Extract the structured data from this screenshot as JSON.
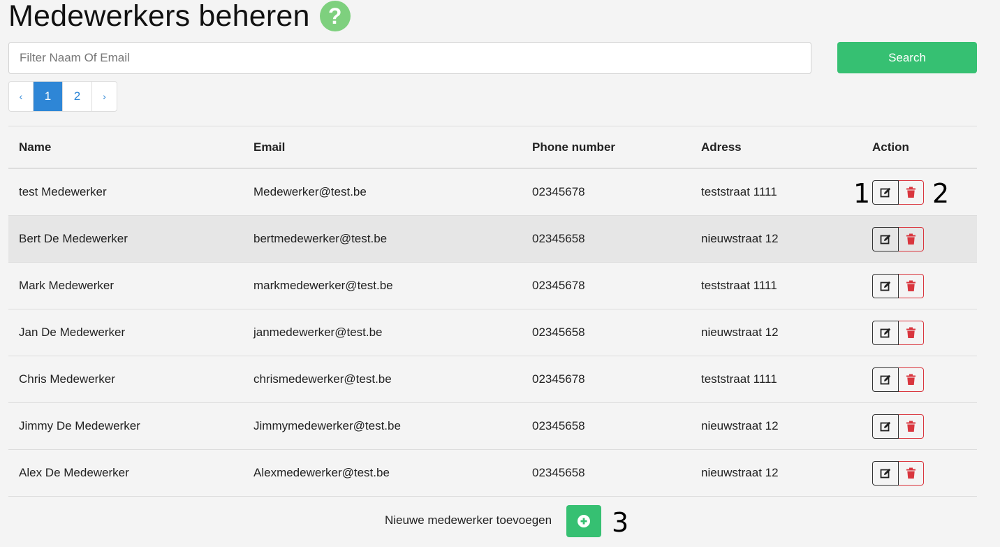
{
  "header": {
    "title": "Medewerkers beheren",
    "help_icon": "question-circle-icon",
    "help_color": "#7ed07e"
  },
  "search": {
    "placeholder": "Filter Naam Of Email",
    "value": "",
    "button_label": "Search",
    "button_color": "#36c072"
  },
  "pagination": {
    "prev": "‹",
    "pages": [
      "1",
      "2"
    ],
    "next": "›",
    "active_page": "1",
    "accent": "#2e86d6"
  },
  "table": {
    "columns": [
      "Name",
      "Email",
      "Phone number",
      "Adress",
      "Action"
    ],
    "rows": [
      {
        "name": "test Medewerker",
        "email": "Medewerker@test.be",
        "phone": "02345678",
        "address": "teststraat 1111"
      },
      {
        "name": "Bert De Medewerker",
        "email": "bertmedewerker@test.be",
        "phone": "02345658",
        "address": "nieuwstraat 12"
      },
      {
        "name": "Mark Medewerker",
        "email": "markmedewerker@test.be",
        "phone": "02345678",
        "address": "teststraat 1111"
      },
      {
        "name": "Jan De Medewerker",
        "email": "janmedewerker@test.be",
        "phone": "02345658",
        "address": "nieuwstraat 12"
      },
      {
        "name": "Chris Medewerker",
        "email": "chrismedewerker@test.be",
        "phone": "02345678",
        "address": "teststraat 1111"
      },
      {
        "name": "Jimmy De Medewerker",
        "email": "Jimmymedewerker@test.be",
        "phone": "02345658",
        "address": "nieuwstraat 12"
      },
      {
        "name": "Alex De Medewerker",
        "email": "Alexmedewerker@test.be",
        "phone": "02345658",
        "address": "nieuwstraat 12"
      }
    ],
    "edit_icon": "edit-icon",
    "delete_icon": "trash-icon",
    "delete_color": "#d9363e"
  },
  "annotations": {
    "edit_marker": "1",
    "delete_marker": "2",
    "add_marker": "3"
  },
  "footer": {
    "add_label": "Nieuwe medewerker toevoegen",
    "add_icon": "plus-circle-icon"
  }
}
